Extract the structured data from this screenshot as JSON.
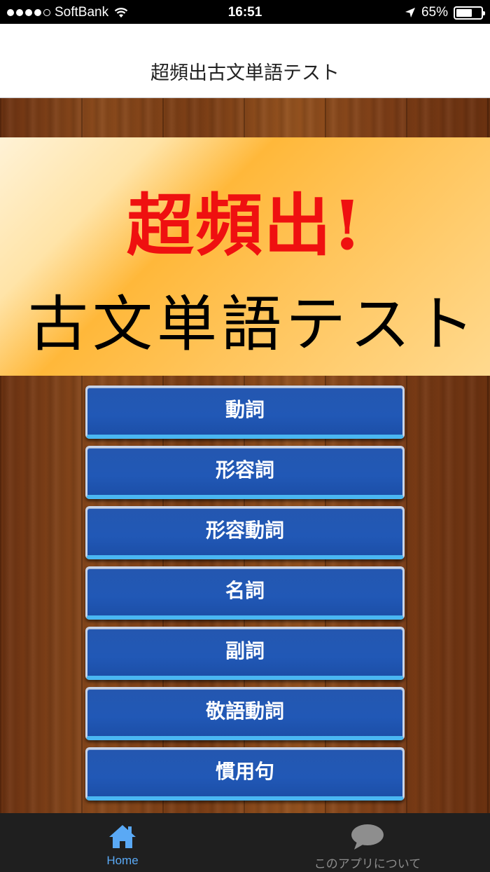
{
  "status_bar": {
    "carrier": "SoftBank",
    "time": "16:51",
    "battery": "65%",
    "battery_level": 0.65
  },
  "nav": {
    "title": "超頻出古文単語テスト"
  },
  "banner": {
    "line1": "超頻出!",
    "line2": "古文単語テスト"
  },
  "menu": {
    "items": [
      {
        "label": "動詞"
      },
      {
        "label": "形容詞"
      },
      {
        "label": "形容動詞"
      },
      {
        "label": "名詞"
      },
      {
        "label": "副詞"
      },
      {
        "label": "敬語動詞"
      },
      {
        "label": "慣用句"
      }
    ]
  },
  "tab_bar": {
    "tabs": [
      {
        "label": "Home",
        "icon": "home-icon",
        "active": true
      },
      {
        "label": "このアプリについて",
        "icon": "speech-bubble-icon",
        "active": false
      }
    ]
  },
  "colors": {
    "accent": "#5aa9f5",
    "button": "#2158b6",
    "banner_red": "#ef1010"
  }
}
